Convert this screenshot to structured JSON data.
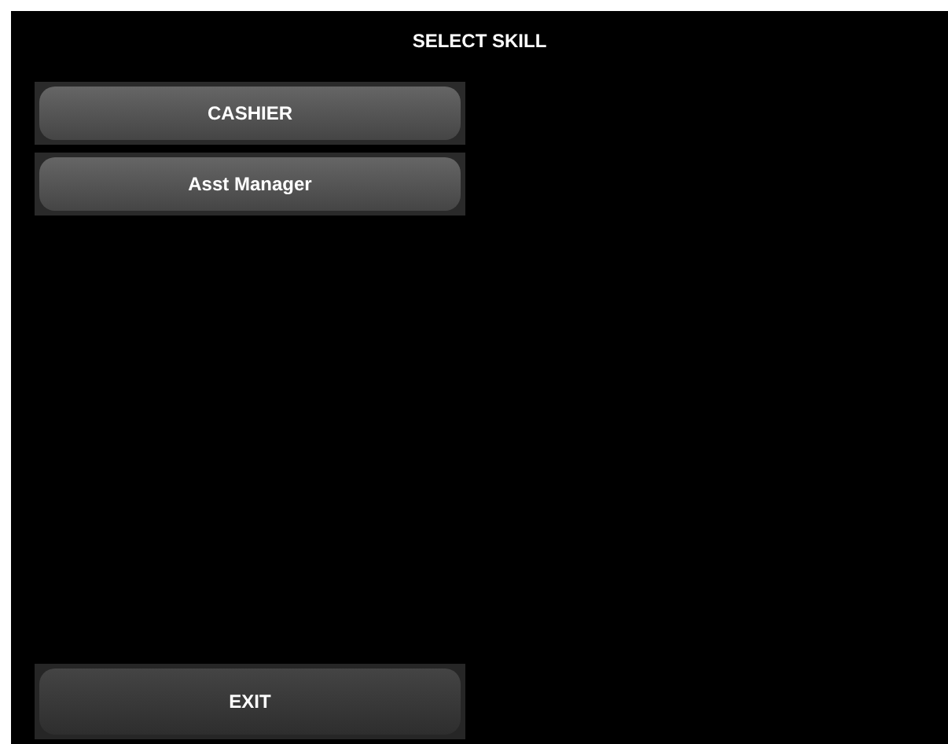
{
  "title": "SELECT SKILL",
  "skills": [
    {
      "label": "CASHIER"
    },
    {
      "label": "Asst Manager"
    }
  ],
  "exit_button": {
    "label": "EXIT"
  }
}
